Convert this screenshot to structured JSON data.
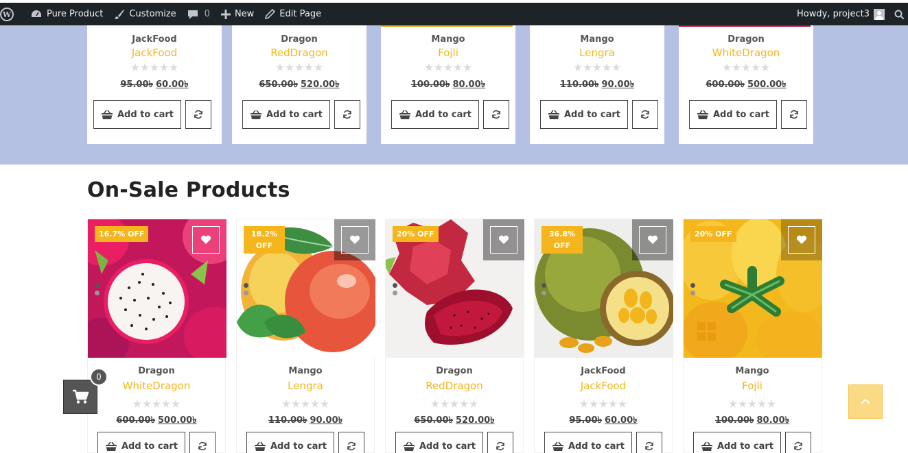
{
  "adminbar": {
    "site_name": "Pure Product",
    "customize": "Customize",
    "comments_count": "0",
    "new": "New",
    "edit_page": "Edit Page",
    "howdy": "Howdy, project3"
  },
  "top_products": [
    {
      "category": "JackFood",
      "name": "JackFood",
      "old_price": "95.00৳",
      "new_price": "60.00৳",
      "cart": "Add to cart",
      "strip": "#ffffff"
    },
    {
      "category": "Dragon",
      "name": "RedDragon",
      "old_price": "650.00৳",
      "new_price": "520.00৳",
      "cart": "Add to cart",
      "strip": "#ffffff"
    },
    {
      "category": "Mango",
      "name": "Fojli",
      "old_price": "100.00৳",
      "new_price": "80.00৳",
      "cart": "Add to cart",
      "strip": "#e8a215"
    },
    {
      "category": "Mango",
      "name": "Lengra",
      "old_price": "110.00৳",
      "new_price": "90.00৳",
      "cart": "Add to cart",
      "strip": "#ffffff"
    },
    {
      "category": "Dragon",
      "name": "WhiteDragon",
      "old_price": "600.00৳",
      "new_price": "500.00৳",
      "cart": "Add to cart",
      "strip": "#b0133a"
    }
  ],
  "section_title": "On-Sale Products",
  "sale_products": [
    {
      "badge_line1": "16.7% OFF",
      "badge_line2": "",
      "category": "Dragon",
      "name": "WhiteDragon",
      "old_price": "600.00৳",
      "new_price": "500.00৳",
      "cart": "Add to cart",
      "image": "white-dragon-fruit"
    },
    {
      "badge_line1": "18.2%",
      "badge_line2": "OFF",
      "category": "Mango",
      "name": "Lengra",
      "old_price": "110.00৳",
      "new_price": "90.00৳",
      "cart": "Add to cart",
      "image": "lengra-mango"
    },
    {
      "badge_line1": "20% OFF",
      "badge_line2": "",
      "category": "Dragon",
      "name": "RedDragon",
      "old_price": "650.00৳",
      "new_price": "520.00৳",
      "cart": "Add to cart",
      "image": "red-dragon-fruit"
    },
    {
      "badge_line1": "36.8%",
      "badge_line2": "OFF",
      "category": "JackFood",
      "name": "JackFood",
      "old_price": "95.00৳",
      "new_price": "60.00৳",
      "cart": "Add to cart",
      "image": "jackfruit"
    },
    {
      "badge_line1": "20% OFF",
      "badge_line2": "",
      "category": "Mango",
      "name": "Fojli",
      "old_price": "100.00৳",
      "new_price": "80.00৳",
      "cart": "Add to cart",
      "image": "fojli-mango"
    }
  ],
  "mini_cart_count": "0",
  "colors": {
    "accent": "#f5b51d",
    "band": "#b4c1e3",
    "adminbar": "#1d2327"
  }
}
